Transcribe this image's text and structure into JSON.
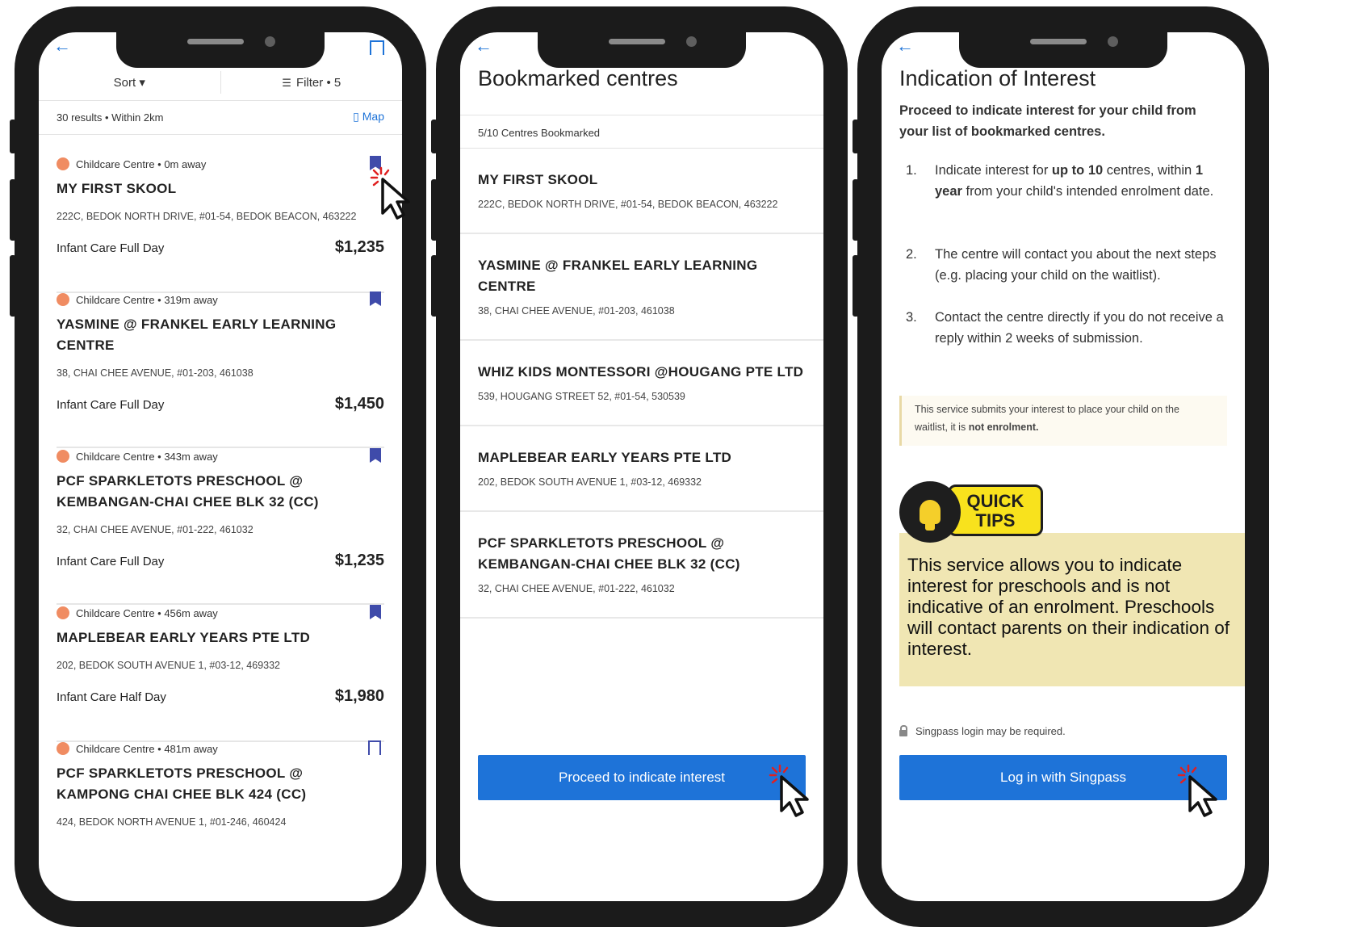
{
  "phone1": {
    "sort_label": "Sort ▾",
    "filter_label": "Filter • 5",
    "results_text": "30 results • Within 2km",
    "map_label": "Map",
    "cards": [
      {
        "type": "Childcare Centre • 0m away",
        "name": "MY FIRST SKOOL",
        "address": "222C, BEDOK NORTH DRIVE, #01-54, BEDOK BEACON, 463222",
        "plan": "Infant Care Full Day",
        "price": "$1,235"
      },
      {
        "type": "Childcare Centre • 319m away",
        "name": "YASMINE @ FRANKEL EARLY LEARNING CENTRE",
        "address": "38, CHAI CHEE AVENUE, #01-203, 461038",
        "plan": "Infant Care Full Day",
        "price": "$1,450"
      },
      {
        "type": "Childcare Centre • 343m away",
        "name": "PCF SPARKLETOTS PRESCHOOL @ KEMBANGAN-CHAI CHEE BLK 32 (CC)",
        "address": "32, CHAI CHEE AVENUE, #01-222, 461032",
        "plan": "Infant Care Full Day",
        "price": "$1,235"
      },
      {
        "type": "Childcare Centre • 456m away",
        "name": "MAPLEBEAR EARLY YEARS PTE LTD",
        "address": "202, BEDOK SOUTH AVENUE 1, #03-12, 469332",
        "plan": "Infant Care Half Day",
        "price": "$1,980"
      },
      {
        "type": "Childcare Centre • 481m away",
        "name": "PCF SPARKLETOTS PRESCHOOL @ KAMPONG CHAI CHEE BLK 424 (CC)",
        "address": "424, BEDOK NORTH AVENUE 1, #01-246, 460424"
      }
    ]
  },
  "phone2": {
    "title": "Bookmarked centres",
    "count_text": "5/10 Centres Bookmarked",
    "centres": [
      {
        "name": "MY FIRST SKOOL",
        "address": "222C, BEDOK NORTH DRIVE, #01-54, BEDOK BEACON, 463222"
      },
      {
        "name": "YASMINE @ FRANKEL EARLY LEARNING CENTRE",
        "address": "38, CHAI CHEE AVENUE, #01-203, 461038"
      },
      {
        "name": "WHIZ KIDS MONTESSORI @HOUGANG PTE LTD",
        "address": "539, HOUGANG STREET 52, #01-54, 530539"
      },
      {
        "name": "MAPLEBEAR EARLY YEARS PTE LTD",
        "address": "202, BEDOK SOUTH AVENUE 1, #03-12, 469332"
      },
      {
        "name": "PCF SPARKLETOTS PRESCHOOL @ KEMBANGAN-CHAI CHEE BLK 32 (CC)",
        "address": "32, CHAI CHEE AVENUE, #01-222, 461032"
      }
    ],
    "button_label": "Proceed to indicate interest"
  },
  "phone3": {
    "title": "Indication of Interest",
    "intro": "Proceed to indicate interest for your child from your list of bookmarked centres.",
    "steps": [
      {
        "num": "1.",
        "text_before": "Indicate interest for ",
        "bold1": "up to 10",
        "text_mid": " centres, within ",
        "bold2": "1 year",
        "text_after": " from your child's intended enrolment date."
      },
      {
        "num": "2.",
        "text": "The centre will contact you about the next steps (e.g. placing your child on the waitlist)."
      },
      {
        "num": "3.",
        "text": "Contact the centre directly if you do not receive a reply within 2 weeks of submission."
      }
    ],
    "note_text": "This service submits your interest to place your child on the waitlist, it is ",
    "note_bold": "not enrolment.",
    "tips_label_1": "QUICK",
    "tips_label_2": "TIPS",
    "tips_text": "This service allows you to indicate interest for preschools and is not indicative of an enrolment. Preschools will contact parents on their indication of interest.",
    "singpass_note": "Singpass login may be required.",
    "button_label": "Log in with Singpass"
  },
  "colors": {
    "primary": "#1e73d8",
    "bookmark": "#3f4baa",
    "tips_bg": "#f0e6b3",
    "tips_badge": "#f8e21d",
    "click_burst": "#e02020"
  }
}
